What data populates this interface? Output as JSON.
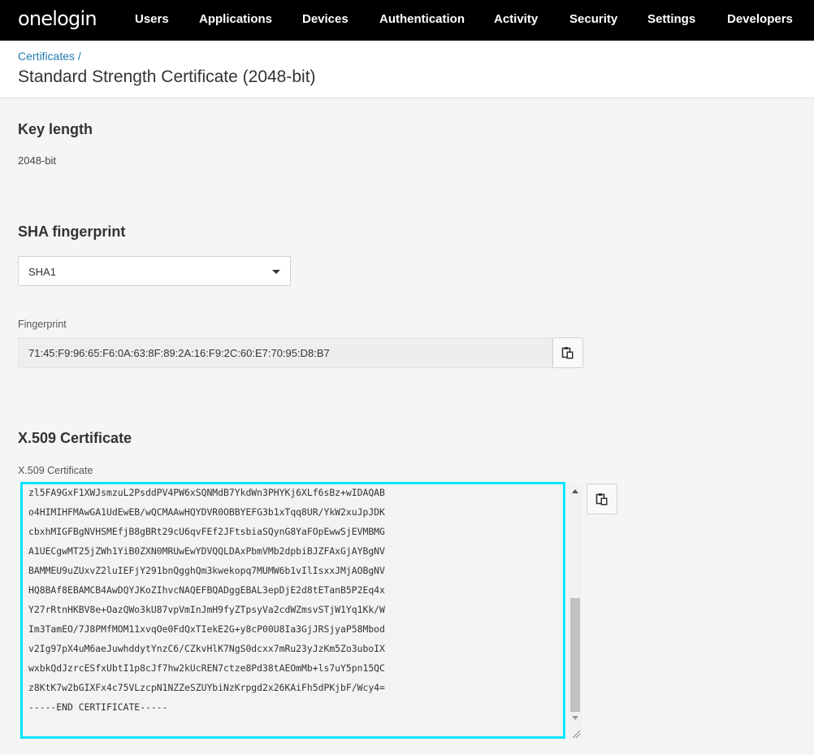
{
  "brand": "onelogin",
  "nav": [
    "Users",
    "Applications",
    "Devices",
    "Authentication",
    "Activity",
    "Security",
    "Settings",
    "Developers"
  ],
  "breadcrumb": {
    "parent": "Certificates",
    "separator": "/"
  },
  "page_title": "Standard Strength Certificate (2048-bit)",
  "key_length": {
    "heading": "Key length",
    "value": "2048-bit"
  },
  "sha": {
    "heading": "SHA fingerprint",
    "selected": "SHA1"
  },
  "fingerprint": {
    "label": "Fingerprint",
    "value": "71:45:F9:96:65:F6:0A:63:8F:89:2A:16:F9:2C:60:E7:70:95:D8:B7"
  },
  "x509": {
    "heading": "X.509 Certificate",
    "label": "X.509 Certificate",
    "lines": [
      "zl5FA9GxF1XWJsmzuL2PsddPV4PW6xSQNMdB7YkdWn3PHYKj6XLf6sBz+wIDAQAB",
      "o4HIMIHFMAwGA1UdEwEB/wQCMAAwHQYDVR0OBBYEFG3b1xTqq8UR/YkW2xuJpJDK",
      "cbxhMIGFBgNVHSMEfjB8gBRt29cU6qvFEf2JFtsbiaSQynG8YaFOpEwwSjEVMBMG",
      "A1UECgwMT25jZWh1YiB0ZXN0MRUwEwYDVQQLDAxPbmVMb2dpbiBJZFAxGjAYBgNV",
      "BAMMEU9uZUxvZ2luIEFjY291bnQgghQm3kwekopq7MUMW6b1vIlIsxxJMjAOBgNV",
      "HQ8BAf8EBAMCB4AwDQYJKoZIhvcNAQEFBQADggEBAL3epDjE2d8tETanB5P2Eq4x",
      "Y27rRtnHKBV8e+OazQWo3kU87vpVmInJmH9fyZTpsyVa2cdWZmsvSTjW1Yq1Kk/W",
      "Im3TamEO/7J8PMfMOM11xvqOe0FdQxTIekE2G+y8cP00U8Ia3GjJRSjyaP58Mbod",
      "v2Ig97pX4uM6aeJuwhddytYnzC6/CZkvHlK7NgS0dcxx7mRu23yJzKm5Zo3uboIX",
      "wxbkQdJzrcESfxUbtI1p8cJf7hw2kUcREN7ctze8Pd38tAEOmMb+ls7uY5pn15QC",
      "z8KtK7w2bGIXFx4c75VLzcpN1NZZeSZUYbiNzKrpgd2x26KAiFh5dPKjbF/Wcy4=",
      "-----END CERTIFICATE-----"
    ]
  },
  "icons": {
    "copy": "clipboard-icon",
    "dropdown": "caret-down-icon"
  }
}
